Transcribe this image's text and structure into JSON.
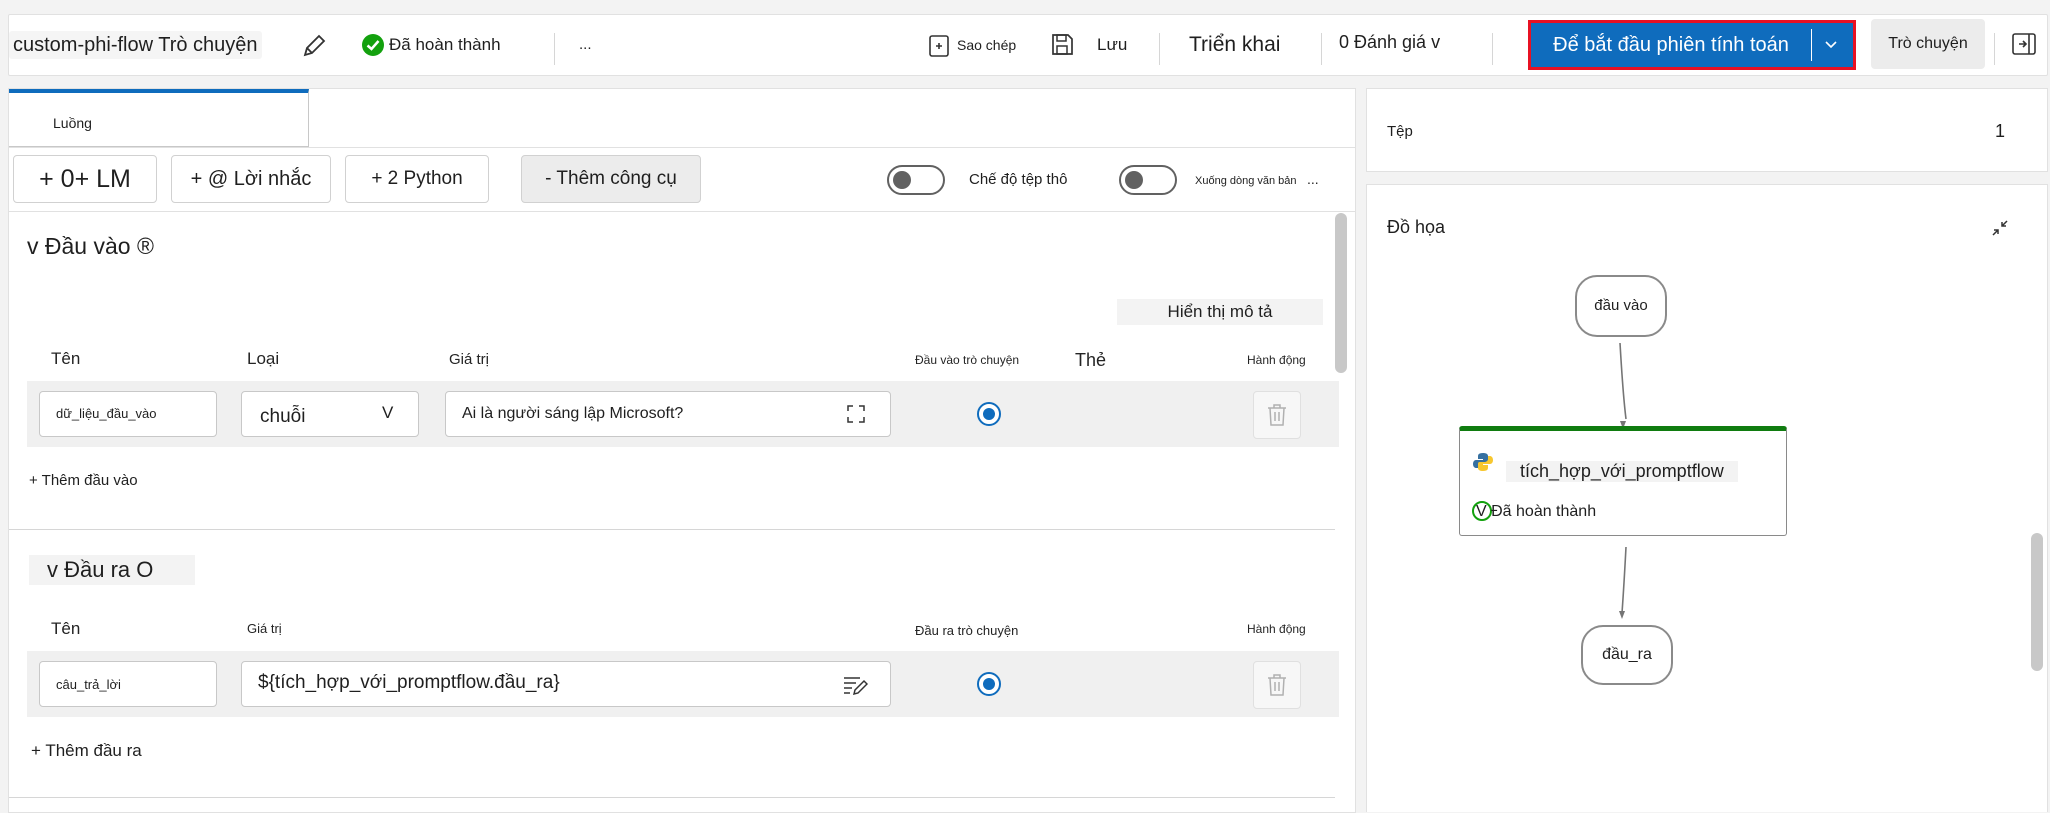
{
  "header": {
    "flow_name": "custom-phi-flow Trò chuyện",
    "status": "Đã hoàn thành",
    "more": "...",
    "clone_label": "Sao chép",
    "save_label": "Lưu",
    "deploy_label": "Triển khai",
    "evaluate_label": "0 Đánh giá v",
    "start_compute_label": "Để bắt đầu phiên tính toán",
    "chat_label": "Trò chuyện"
  },
  "tabs": [
    {
      "label": "Luồng"
    }
  ],
  "toolbar": {
    "llm_label": "+ 0+ LM",
    "prompt_label": "+ @ Lời nhắc",
    "python_label": "+ 2 Python",
    "add_tool_label": "- Thêm công cụ",
    "raw_file_mode_label": "Chế độ tệp thô",
    "line_wrap_label": "Xuống dòng văn bản",
    "more": "..."
  },
  "inputs": {
    "section_title": "v Đầu vào ®",
    "show_description_label": "Hiển thị mô tả",
    "columns": {
      "name": "Tên",
      "type": "Loại",
      "value": "Giá trị",
      "chat_input": "Đầu vào trò chuyện",
      "tags": "Thẻ",
      "actions": "Hành động"
    },
    "rows": [
      {
        "name": "dữ_liệu_đầu_vào",
        "type": "chuỗi",
        "type_chevron": "V",
        "value": "Ai là người sáng lập Microsoft?"
      }
    ],
    "add_label": "+ Thêm đầu vào"
  },
  "outputs": {
    "section_title": "v Đầu ra O",
    "columns": {
      "name": "Tên",
      "value": "Giá trị",
      "chat_output": "Đầu ra trò chuyện",
      "actions": "Hành động"
    },
    "rows": [
      {
        "name": "câu_trả_lời",
        "value": "${tích_hợp_với_promptflow.đầu_ra}"
      }
    ],
    "add_label": "+ Thêm đầu ra"
  },
  "files": {
    "label": "Tệp",
    "count": "1"
  },
  "graph": {
    "title": "Đồ họa",
    "input_node": "đầu vào",
    "tool_node": "tích_hợp_với_promptflow",
    "tool_status": "V Đã hoàn thành",
    "output_node": "đầu_ra"
  },
  "colors": {
    "primary": "#0f6cbd",
    "highlight_border": "#e81123",
    "success": "#13a10e",
    "node_accent": "#107c10"
  },
  "icons": {
    "edit": "pencil-icon",
    "status": "check-circle-icon",
    "clone": "copy-icon",
    "save": "save-icon",
    "expand": "expand-icon",
    "delete": "trash-icon",
    "collapse": "collapse-icon",
    "python": "python-icon"
  }
}
